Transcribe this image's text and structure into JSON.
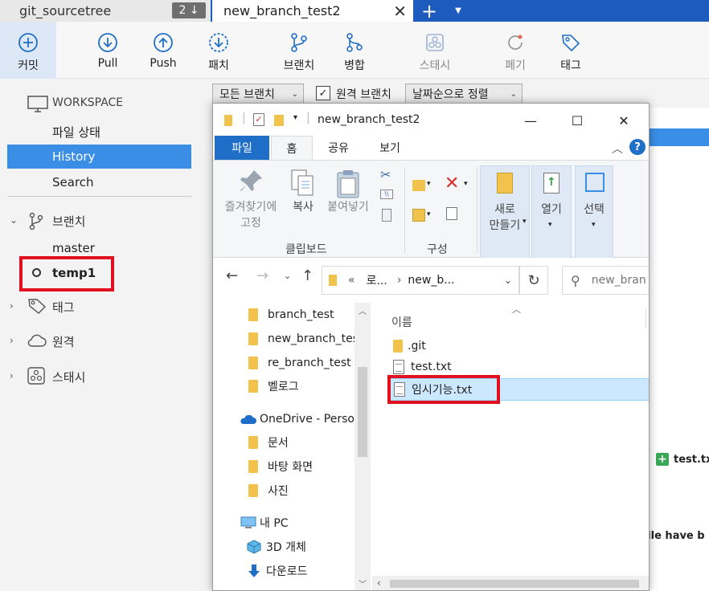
{
  "tabs": [
    {
      "label": "git_sourcetree",
      "count": "2 ↓"
    },
    {
      "label": "new_branch_test2",
      "close": "✕"
    }
  ],
  "tab_add": "+",
  "toolbar": {
    "commit": "커밋",
    "pull": "Pull",
    "push": "Push",
    "fetch": "패치",
    "branch": "브랜치",
    "merge": "병합",
    "stash": "스태시",
    "discard": "폐기",
    "tag": "태그"
  },
  "sidebar": {
    "workspace": "WORKSPACE",
    "file_status": "파일 상태",
    "history": "History",
    "search": "Search",
    "branches": "브랜치",
    "master": "master",
    "temp1": "temp1",
    "tags": "태그",
    "remotes": "원격",
    "stashes": "스태시"
  },
  "filter": {
    "all_branches": "모든 브랜치",
    "remote_branches": "원격 브랜치",
    "sort": "날짜순으로 정렬"
  },
  "rightpane": {
    "file": "test.txt",
    "snippet": "file have b"
  },
  "explorer": {
    "title": "new_branch_test2",
    "ribbon_tabs": {
      "file": "파일",
      "home": "홈",
      "share": "공유",
      "view": "보기"
    },
    "ribbon": {
      "pin": "즐겨찾기에\n고정",
      "copy": "복사",
      "paste": "붙여넣기",
      "clipboard": "클립보드",
      "organize": "구성",
      "new_folder": "새로\n만들기",
      "open": "열기",
      "select": "선택"
    },
    "address": {
      "prefix": "«",
      "crumb1": "로...",
      "sep": "›",
      "crumb2": "new_b...",
      "search_placeholder": "new_bran"
    },
    "nav": {
      "folders": [
        "branch_test",
        "new_branch_test",
        "re_branch_test",
        "벨로그"
      ],
      "onedrive": "OneDrive - Perso",
      "onedrive_folders": [
        "문서",
        "바탕 화면",
        "사진"
      ],
      "pc": "내 PC",
      "pc_items": [
        "3D 개체",
        "다운로드"
      ]
    },
    "list": {
      "header": "이름",
      "files": [
        ".git",
        "test.txt",
        "임시기능.txt"
      ]
    }
  }
}
